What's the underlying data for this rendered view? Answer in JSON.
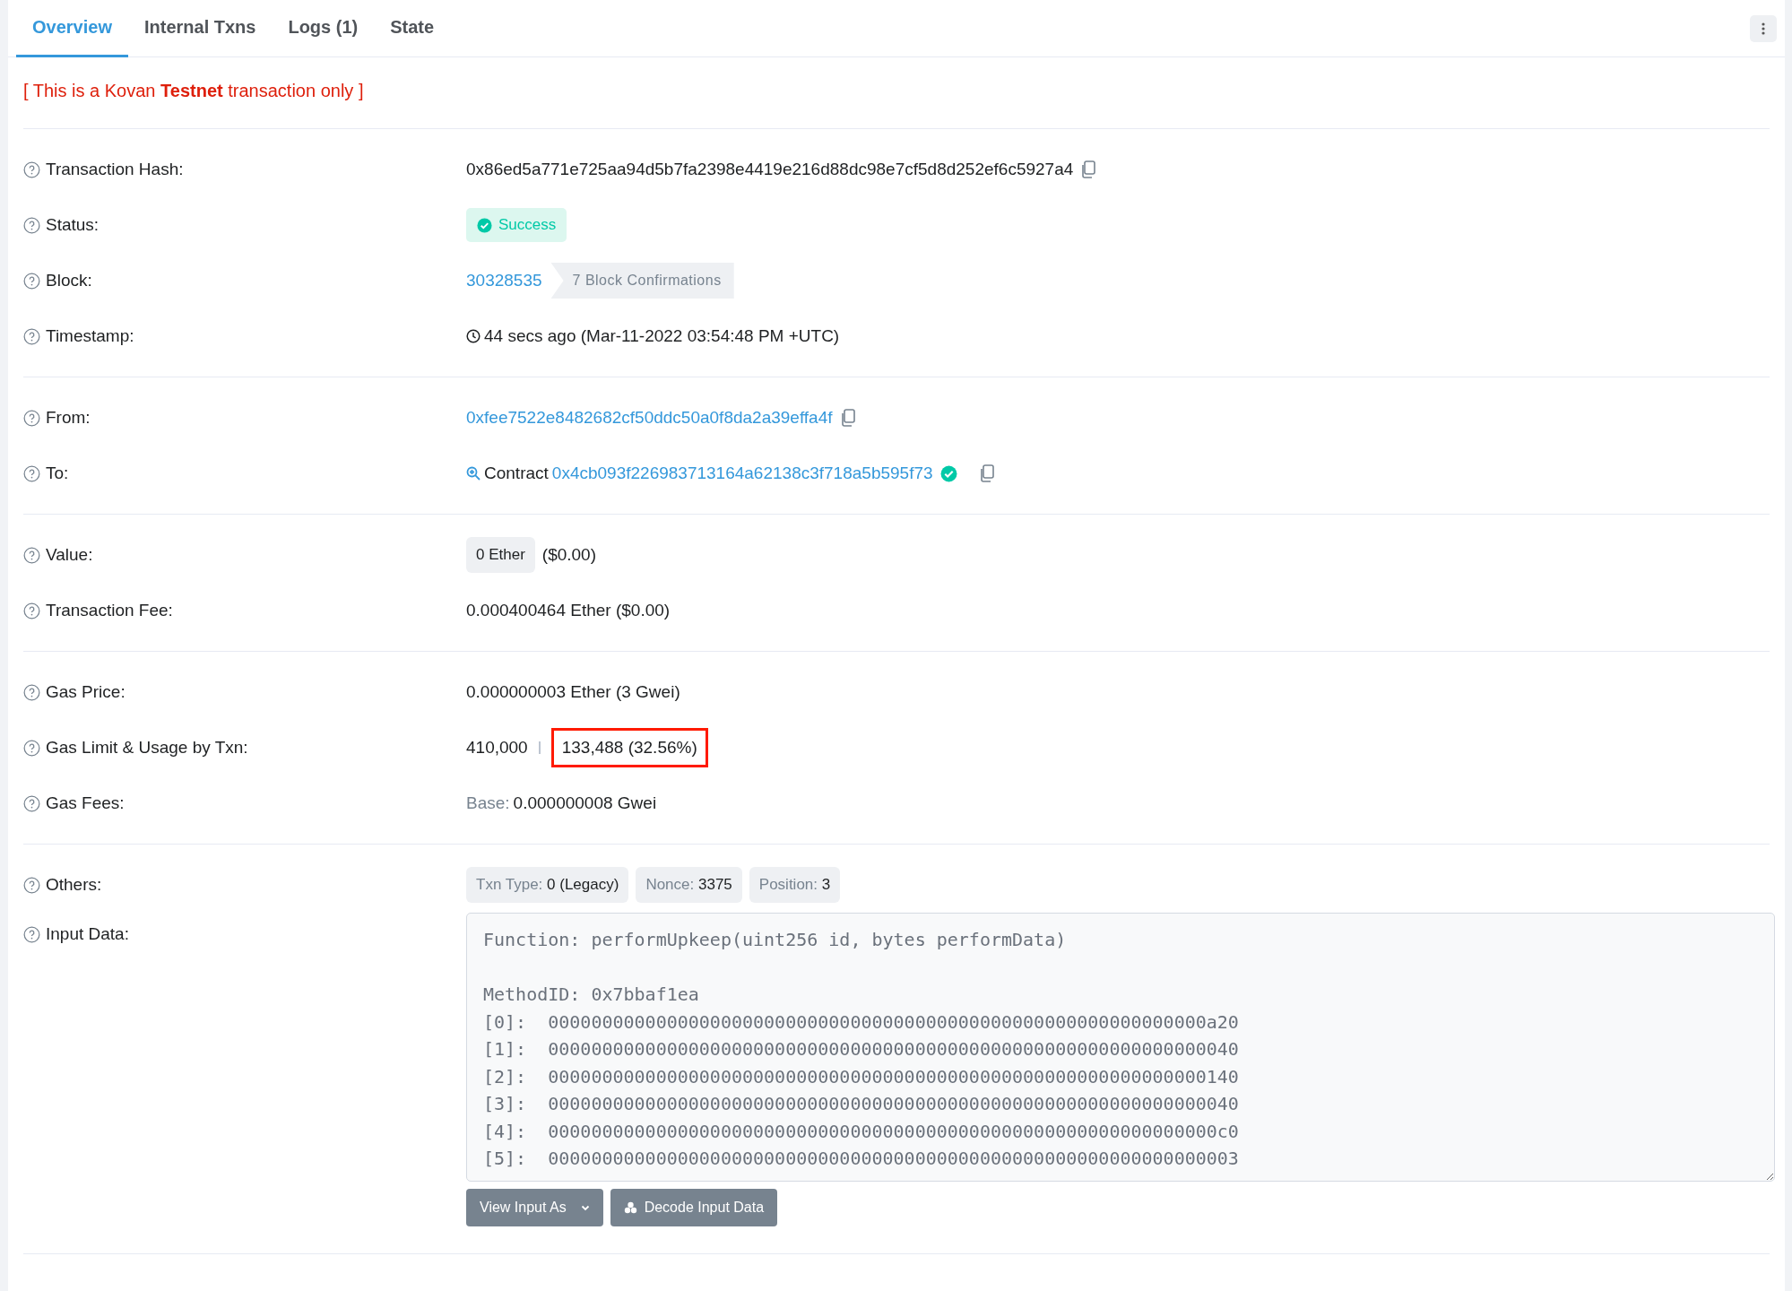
{
  "tabs": [
    {
      "label": "Overview",
      "selected": true
    },
    {
      "label": "Internal Txns",
      "selected": false
    },
    {
      "label": "Logs (1)",
      "selected": false
    },
    {
      "label": "State",
      "selected": false
    }
  ],
  "notice": "[ This is a Kovan **Testnet** transaction only ]",
  "sections": [
    [
      {
        "kind": "hash",
        "label": "Transaction Hash:",
        "value": "0x86ed5a771e725aa94d5b7fa2398e4419e216d88dc98e7cf5d8d252ef6c5927a4"
      },
      {
        "kind": "status",
        "label": "Status:",
        "value": "Success"
      },
      {
        "kind": "block",
        "label": "Block:",
        "value": "30328535",
        "confirmations": "7 Block Confirmations"
      },
      {
        "kind": "timestamp",
        "label": "Timestamp:",
        "value": "44 secs ago (Mar-11-2022 03:54:48 PM +UTC)"
      }
    ],
    [
      {
        "kind": "address",
        "label": "From:",
        "value": "0xfee7522e8482682cf50ddc50a0f8da2a39effa4f"
      },
      {
        "kind": "contract",
        "label": "To:",
        "prefix": "Contract",
        "value": "0x4cb093f226983713164a62138c3f718a5b595f73"
      }
    ],
    [
      {
        "kind": "value",
        "label": "Value:",
        "amount": "0 Ether",
        "fiat": "($0.00)"
      },
      {
        "kind": "text",
        "label": "Transaction Fee:",
        "value": "0.000400464 Ether ($0.00)"
      }
    ],
    [
      {
        "kind": "text",
        "label": "Gas Price:",
        "value": "0.000000003 Ether (3 Gwei)"
      },
      {
        "kind": "gas",
        "label": "Gas Limit & Usage by Txn:",
        "limit": "410,000",
        "usage": "133,488 (32.56%)",
        "highlighted": true
      },
      {
        "kind": "base",
        "label": "Gas Fees:",
        "prefix": "Base:",
        "value": "0.000000008 Gwei"
      }
    ],
    [
      {
        "kind": "pills",
        "label": "Others:",
        "items": [
          {
            "name": "Txn Type:",
            "value": "0 (Legacy)"
          },
          {
            "name": "Nonce:",
            "value": "3375"
          },
          {
            "name": "Position:",
            "value": "3"
          }
        ]
      },
      {
        "kind": "input",
        "label": "Input Data:",
        "function": "Function: performUpkeep(uint256 id, bytes performData)",
        "lines": [
          "MethodID: 0x7bbaf1ea",
          "[0]:  0000000000000000000000000000000000000000000000000000000000000a20",
          "[1]:  0000000000000000000000000000000000000000000000000000000000000040",
          "[2]:  0000000000000000000000000000000000000000000000000000000000000140",
          "[3]:  0000000000000000000000000000000000000000000000000000000000000040",
          "[4]:  00000000000000000000000000000000000000000000000000000000000000c0",
          "[5]:  0000000000000000000000000000000000000000000000000000000000000003"
        ],
        "buttons": [
          {
            "kind": "dropdown",
            "label": "View Input As"
          },
          {
            "kind": "decode",
            "label": "Decode Input Data"
          }
        ]
      }
    ]
  ]
}
